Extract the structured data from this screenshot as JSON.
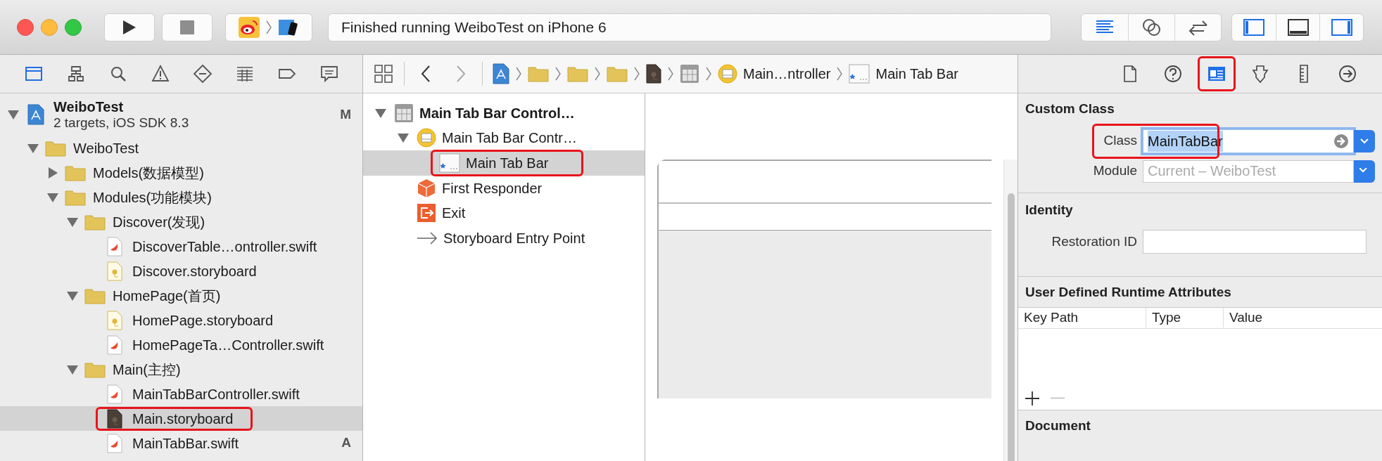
{
  "toolbar": {
    "status": "Finished running WeiboTest on iPhone 6",
    "editor_modes": [
      {
        "selected": true
      },
      {
        "selected": false
      },
      {
        "selected": false
      }
    ],
    "panels": [
      {
        "on": true
      },
      {
        "on": false
      },
      {
        "on": true
      }
    ]
  },
  "navigator_tabs": [
    {
      "selected": true
    },
    {
      "selected": false
    },
    {
      "selected": false
    },
    {
      "selected": false
    },
    {
      "selected": false
    },
    {
      "selected": false
    },
    {
      "selected": false
    },
    {
      "selected": false
    }
  ],
  "project_tree": [
    {
      "kind": "project",
      "label": "WeiboTest",
      "subtitle": "2 targets, iOS SDK 8.3",
      "badge": "M",
      "expanded": true,
      "selected": false,
      "highlighted": false,
      "children": [
        {
          "kind": "folder",
          "label": "WeiboTest",
          "expanded": true,
          "selected": false,
          "highlighted": false,
          "children": [
            {
              "kind": "folder",
              "label": "Models(数据模型)",
              "expanded": false,
              "selected": false,
              "highlighted": false
            },
            {
              "kind": "folder",
              "label": "Modules(功能模块)",
              "expanded": true,
              "selected": false,
              "highlighted": false,
              "children": [
                {
                  "kind": "folder",
                  "label": "Discover(发现)",
                  "expanded": true,
                  "selected": false,
                  "highlighted": false,
                  "children": [
                    {
                      "kind": "swift",
                      "label": "DiscoverTable…ontroller.swift",
                      "selected": false,
                      "highlighted": false
                    },
                    {
                      "kind": "storyboard",
                      "label": "Discover.storyboard",
                      "selected": false,
                      "highlighted": false
                    }
                  ]
                },
                {
                  "kind": "folder",
                  "label": "HomePage(首页)",
                  "expanded": true,
                  "selected": false,
                  "highlighted": false,
                  "children": [
                    {
                      "kind": "storyboard",
                      "label": "HomePage.storyboard",
                      "selected": false,
                      "highlighted": false
                    },
                    {
                      "kind": "swift",
                      "label": "HomePageTa…Controller.swift",
                      "selected": false,
                      "highlighted": false
                    }
                  ]
                },
                {
                  "kind": "folder",
                  "label": "Main(主控)",
                  "expanded": true,
                  "selected": false,
                  "highlighted": false,
                  "children": [
                    {
                      "kind": "swift",
                      "label": "MainTabBarController.swift",
                      "selected": false,
                      "highlighted": false
                    },
                    {
                      "kind": "storyboard",
                      "label": "Main.storyboard",
                      "selected": true,
                      "highlighted": true
                    },
                    {
                      "kind": "swift",
                      "label": "MainTabBar.swift",
                      "badge": "A",
                      "selected": false,
                      "highlighted": false
                    }
                  ]
                }
              ]
            }
          ]
        }
      ]
    }
  ],
  "jump_bar": {
    "back": {
      "disabled": false
    },
    "forward": {
      "disabled": true
    },
    "items": [
      {
        "kind": "project"
      },
      {
        "kind": "folder"
      },
      {
        "kind": "folder"
      },
      {
        "kind": "folder"
      },
      {
        "kind": "storyboard"
      },
      {
        "kind": "scene"
      },
      {
        "kind": "controller",
        "label": "Main…ntroller"
      },
      {
        "kind": "view",
        "label": "Main Tab Bar"
      }
    ]
  },
  "outline": [
    {
      "kind": "scene",
      "label": "Main Tab Bar Control…",
      "expanded": true,
      "selected": false,
      "highlighted": false,
      "children": [
        {
          "kind": "controller",
          "label": "Main Tab Bar Contr…",
          "expanded": true,
          "selected": false,
          "highlighted": false,
          "children": [
            {
              "kind": "view",
              "label": "Main Tab Bar",
              "selected": true,
              "highlighted": true
            }
          ]
        },
        {
          "kind": "responder",
          "label": "First Responder",
          "selected": false,
          "highlighted": false
        },
        {
          "kind": "exit",
          "label": "Exit",
          "selected": false,
          "highlighted": false
        },
        {
          "kind": "entry",
          "label": "Storyboard Entry Point",
          "selected": false,
          "highlighted": false
        }
      ]
    }
  ],
  "inspector": {
    "tabs": [
      {
        "selected": false,
        "highlighted": false
      },
      {
        "selected": false,
        "highlighted": false
      },
      {
        "selected": true,
        "highlighted": true
      },
      {
        "selected": false,
        "highlighted": false
      },
      {
        "selected": false,
        "highlighted": false
      },
      {
        "selected": false,
        "highlighted": false
      }
    ],
    "custom_class": {
      "title": "Custom Class",
      "class_label": "Class",
      "class_value": "MainTabBar",
      "class_value_selected": true,
      "highlighted": true,
      "module_label": "Module",
      "module_placeholder": "Current – WeiboTest"
    },
    "identity": {
      "title": "Identity",
      "restoration_id_label": "Restoration ID"
    },
    "runtime_attributes": {
      "title": "User Defined Runtime Attributes",
      "columns": [
        "Key Path",
        "Type",
        "Value"
      ],
      "remove_button": {
        "disabled": true
      }
    },
    "document": {
      "title": "Document"
    }
  }
}
